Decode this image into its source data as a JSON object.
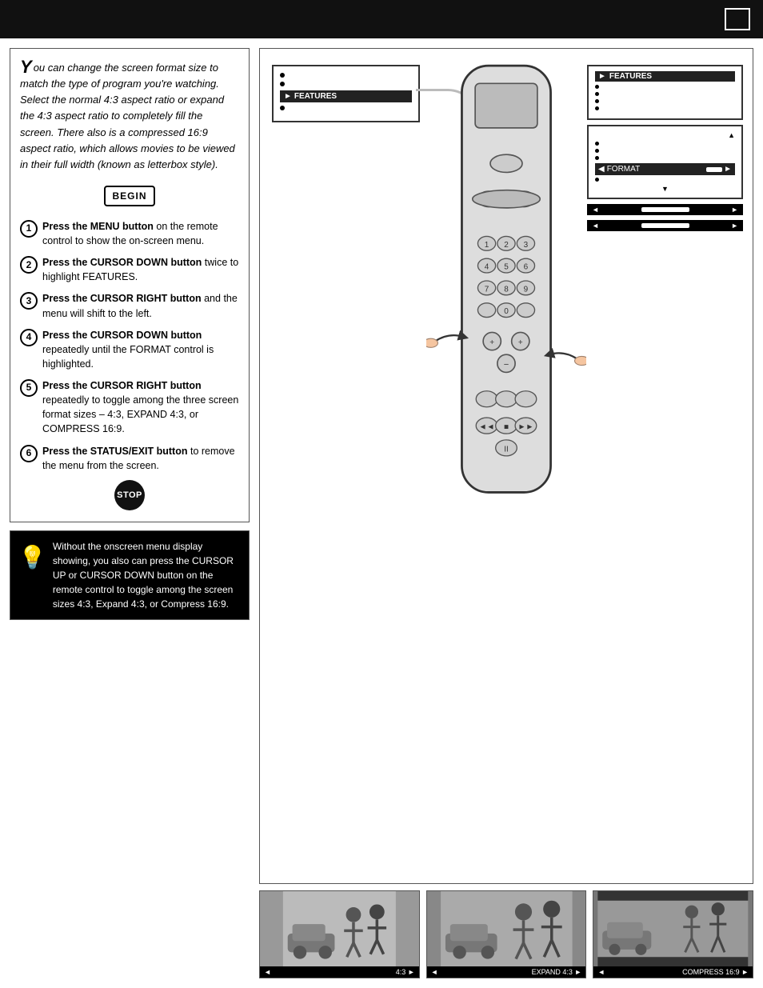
{
  "header": {
    "page_number": ""
  },
  "left_col": {
    "intro": {
      "drop_cap": "Y",
      "text": "ou can change the screen format size to match the type of program you're watching. Select the normal 4:3 aspect ratio or expand the 4:3 aspect ratio to completely fill the screen. There also is a compressed 16:9 aspect ratio, which allows movies to be viewed in their full width (known as letterbox style)."
    },
    "begin_label": "BEGIN",
    "steps": [
      {
        "num": "1",
        "text_bold": "Press the MENU button",
        "text_rest": " on the remote control to show the on-screen menu."
      },
      {
        "num": "2",
        "text_bold": "Press the CURSOR DOWN button",
        "text_rest": " twice to highlight FEATURES."
      },
      {
        "num": "3",
        "text_bold": "Press the CURSOR RIGHT button",
        "text_rest": " and the menu will shift to the left."
      },
      {
        "num": "4",
        "text_bold": "Press the CURSOR DOWN button",
        "text_rest": " repeatedly until the FORMAT control is highlighted."
      },
      {
        "num": "5",
        "text_bold": "Press the CURSOR RIGHT button",
        "text_rest": " repeatedly to toggle among the three screen format sizes – 4:3, EXPAND 4:3, or COMPRESS 16:9."
      },
      {
        "num": "6",
        "text_bold": "Press the STATUS/EXIT button",
        "text_rest": " to remove the menu from the screen."
      }
    ],
    "stop_label": "STOP",
    "tip": {
      "text": "Without the onscreen menu display showing, you also can press the CURSOR UP or CURSOR DOWN button on the remote control to toggle among the screen sizes 4:3, Expand 4:3, or Compress 16:9."
    }
  },
  "menus": {
    "top_menu": {
      "items": [
        "",
        "",
        "FEATURES"
      ]
    },
    "features_menu": {
      "items": [
        "",
        "",
        "",
        "FORMAT",
        ""
      ]
    },
    "format_bar1": "◄  ●►",
    "format_bar2": "◄  ●►"
  },
  "thumbnails": [
    {
      "label_left": "◄",
      "label_right": "4:3 ►"
    },
    {
      "label_left": "◄",
      "label_right": "EXPAND 4:3 ►"
    },
    {
      "label_left": "◄",
      "label_right": "COMPRESS 16:9 ►"
    }
  ]
}
